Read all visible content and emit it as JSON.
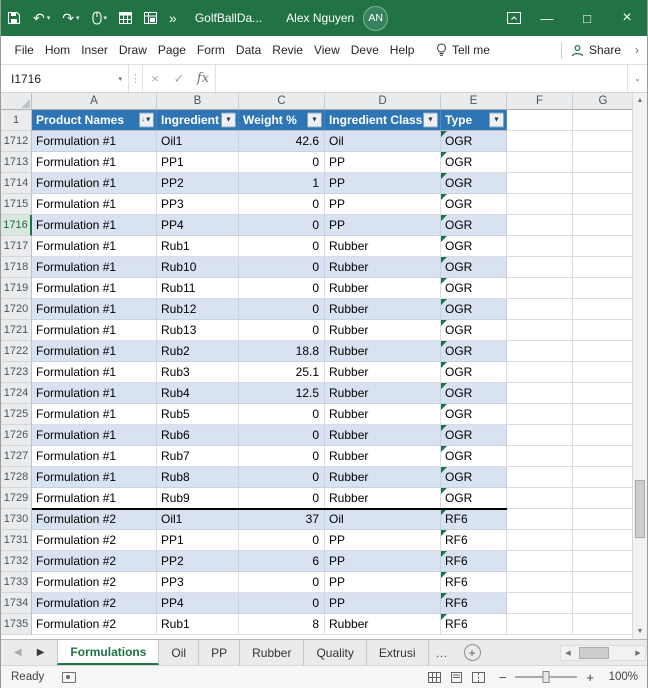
{
  "titlebar": {
    "title": "GolfBallDa...",
    "user": "Alex Nguyen",
    "initials": "AN",
    "qat": {
      "undo": "↶",
      "redo": "↷",
      "overflow": "»"
    },
    "window_buttons": {
      "minimize": "—",
      "maximize": "□",
      "close": "×"
    }
  },
  "ribbon": {
    "tabs": [
      "File",
      "Hom",
      "Inser",
      "Draw",
      "Page",
      "Form",
      "Data",
      "Revie",
      "View",
      "Deve",
      "Help"
    ],
    "tell_me": "Tell me",
    "share": "Share",
    "overflow": "›"
  },
  "formula_bar": {
    "name_box": "I1716",
    "cancel": "×",
    "enter": "✓",
    "fx": "fx",
    "formula": "",
    "expand": "⌄"
  },
  "grid": {
    "column_letters": [
      "A",
      "B",
      "C",
      "D",
      "E",
      "F",
      "G"
    ],
    "table_header": {
      "row_number": "1",
      "cells": [
        "Product Names",
        "Ingredient",
        "Weight %",
        "Ingredient Class",
        "Type"
      ],
      "filter_glyph": "▼",
      "sort_glyph": "↓"
    },
    "active_row": "1716",
    "error_indicator_column": "Type",
    "rows": [
      {
        "n": "1712",
        "cells": [
          "Formulation #1",
          "Oil1",
          "42.6",
          "Oil",
          "OGR"
        ]
      },
      {
        "n": "1713",
        "cells": [
          "Formulation #1",
          "PP1",
          "0",
          "PP",
          "OGR"
        ]
      },
      {
        "n": "1714",
        "cells": [
          "Formulation #1",
          "PP2",
          "1",
          "PP",
          "OGR"
        ]
      },
      {
        "n": "1715",
        "cells": [
          "Formulation #1",
          "PP3",
          "0",
          "PP",
          "OGR"
        ]
      },
      {
        "n": "1716",
        "cells": [
          "Formulation #1",
          "PP4",
          "0",
          "PP",
          "OGR"
        ]
      },
      {
        "n": "1717",
        "cells": [
          "Formulation #1",
          "Rub1",
          "0",
          "Rubber",
          "OGR"
        ]
      },
      {
        "n": "1718",
        "cells": [
          "Formulation #1",
          "Rub10",
          "0",
          "Rubber",
          "OGR"
        ]
      },
      {
        "n": "1719",
        "cells": [
          "Formulation #1",
          "Rub11",
          "0",
          "Rubber",
          "OGR"
        ]
      },
      {
        "n": "1720",
        "cells": [
          "Formulation #1",
          "Rub12",
          "0",
          "Rubber",
          "OGR"
        ]
      },
      {
        "n": "1721",
        "cells": [
          "Formulation #1",
          "Rub13",
          "0",
          "Rubber",
          "OGR"
        ]
      },
      {
        "n": "1722",
        "cells": [
          "Formulation #1",
          "Rub2",
          "18.8",
          "Rubber",
          "OGR"
        ]
      },
      {
        "n": "1723",
        "cells": [
          "Formulation #1",
          "Rub3",
          "25.1",
          "Rubber",
          "OGR"
        ]
      },
      {
        "n": "1724",
        "cells": [
          "Formulation #1",
          "Rub4",
          "12.5",
          "Rubber",
          "OGR"
        ]
      },
      {
        "n": "1725",
        "cells": [
          "Formulation #1",
          "Rub5",
          "0",
          "Rubber",
          "OGR"
        ]
      },
      {
        "n": "1726",
        "cells": [
          "Formulation #1",
          "Rub6",
          "0",
          "Rubber",
          "OGR"
        ]
      },
      {
        "n": "1727",
        "cells": [
          "Formulation #1",
          "Rub7",
          "0",
          "Rubber",
          "OGR"
        ]
      },
      {
        "n": "1728",
        "cells": [
          "Formulation #1",
          "Rub8",
          "0",
          "Rubber",
          "OGR"
        ]
      },
      {
        "n": "1729",
        "cells": [
          "Formulation #1",
          "Rub9",
          "0",
          "Rubber",
          "OGR"
        ]
      },
      {
        "n": "1730",
        "cells": [
          "Formulation #2",
          "Oil1",
          "37",
          "Oil",
          "RF6"
        ],
        "thick_top": true
      },
      {
        "n": "1731",
        "cells": [
          "Formulation #2",
          "PP1",
          "0",
          "PP",
          "RF6"
        ]
      },
      {
        "n": "1732",
        "cells": [
          "Formulation #2",
          "PP2",
          "6",
          "PP",
          "RF6"
        ]
      },
      {
        "n": "1733",
        "cells": [
          "Formulation #2",
          "PP3",
          "0",
          "PP",
          "RF6"
        ]
      },
      {
        "n": "1734",
        "cells": [
          "Formulation #2",
          "PP4",
          "0",
          "PP",
          "RF6"
        ]
      },
      {
        "n": "1735",
        "cells": [
          "Formulation #2",
          "Rub1",
          "8",
          "Rubber",
          "RF6"
        ]
      }
    ]
  },
  "sheet_tabs": {
    "nav_left": "◀",
    "nav_right": "▶",
    "tabs": [
      {
        "label": "Formulations",
        "active": true
      },
      {
        "label": "Oil"
      },
      {
        "label": "PP"
      },
      {
        "label": "Rubber"
      },
      {
        "label": "Quality"
      },
      {
        "label": "Extrusi"
      }
    ],
    "overflow": "…",
    "add_sheet": "+"
  },
  "status_bar": {
    "status": "Ready",
    "zoom_out": "−",
    "zoom_in": "+",
    "zoom_level": "100%"
  },
  "icons": {
    "caret_down": "▾",
    "dots_divider": "⋮",
    "scroll_up": "▲",
    "scroll_down": "▼",
    "scroll_left": "◀",
    "scroll_right": "▶"
  },
  "colors": {
    "titlebar_green": "#217346",
    "table_header_blue": "#2E75B6",
    "band_blue": "#D9E2F1",
    "active_tab_green": "#217346",
    "group_separator": "#000000",
    "error_triangle_green": "#1E7145"
  }
}
